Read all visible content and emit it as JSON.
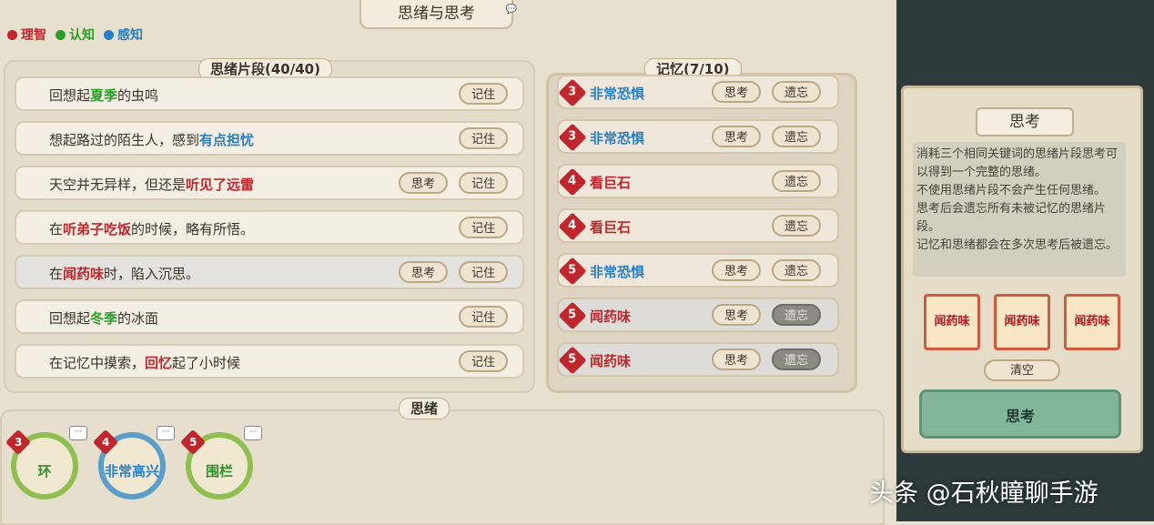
{
  "title": "思绪与思考",
  "legend": [
    {
      "label": "理智",
      "color": "#c0262b"
    },
    {
      "label": "认知",
      "color": "#2aa02a"
    },
    {
      "label": "感知",
      "color": "#2a7fc4"
    }
  ],
  "fragments": {
    "label": "思绪片段(40/40)",
    "rows": [
      {
        "pre": "回想起",
        "kw": "夏季",
        "kwColor": "#2aa02a",
        "post": "的虫鸣",
        "think": "",
        "remember": "记住"
      },
      {
        "pre": "想起路过的陌生人，感到",
        "kw": "有点担忧",
        "kwColor": "#2a7fc4",
        "post": "",
        "think": "",
        "remember": "记住"
      },
      {
        "pre": "天空并无异样，但还是",
        "kw": "听见了远雷",
        "kwColor": "#c0262b",
        "post": "",
        "think": "思考",
        "remember": "记住"
      },
      {
        "pre": "在",
        "kw": "听弟子吃饭",
        "kwColor": "#c0262b",
        "post": "的时候，略有所悟。",
        "think": "",
        "remember": "记住"
      },
      {
        "pre": "在",
        "kw": "闻药味",
        "kwColor": "#c0262b",
        "post": "时，陷入沉思。",
        "think": "思考",
        "remember": "记住"
      },
      {
        "pre": "回想起",
        "kw": "冬季",
        "kwColor": "#2aa02a",
        "post": "的冰面",
        "think": "",
        "remember": "记住"
      },
      {
        "pre": "在记忆中摸索，",
        "kw": "回忆",
        "kwColor": "#c0262b",
        "post": "起了小时候",
        "think": "",
        "remember": "记住"
      }
    ]
  },
  "memory": {
    "label": "记忆(7/10)",
    "rows": [
      {
        "level": "3",
        "text": "非常恐惧",
        "color": "#2a7fc4",
        "think": "思考",
        "forget": "遗忘",
        "gray": false
      },
      {
        "level": "3",
        "text": "非常恐惧",
        "color": "#2a7fc4",
        "think": "思考",
        "forget": "遗忘",
        "gray": false
      },
      {
        "level": "4",
        "text": "看巨石",
        "color": "#c0262b",
        "think": "",
        "forget": "遗忘",
        "gray": false
      },
      {
        "level": "4",
        "text": "看巨石",
        "color": "#c0262b",
        "think": "",
        "forget": "遗忘",
        "gray": false
      },
      {
        "level": "5",
        "text": "非常恐惧",
        "color": "#2a7fc4",
        "think": "思考",
        "forget": "遗忘",
        "gray": false
      },
      {
        "level": "5",
        "text": "闻药味",
        "color": "#c0262b",
        "think": "思考",
        "forget": "遗忘",
        "gray": true
      },
      {
        "level": "5",
        "text": "闻药味",
        "color": "#c0262b",
        "think": "思考",
        "forget": "遗忘",
        "gray": true
      }
    ]
  },
  "thoughts": {
    "label": "思绪",
    "items": [
      {
        "level": "3",
        "label": "环",
        "ring": "#8fc04f",
        "textColor": "#2c8f2c"
      },
      {
        "level": "4",
        "label": "非常高兴",
        "ring": "#5a9ec9",
        "textColor": "#2a7fc4"
      },
      {
        "level": "5",
        "label": "围栏",
        "ring": "#8fc04f",
        "textColor": "#2c8f2c"
      }
    ]
  },
  "side": {
    "title": "思考",
    "desc": [
      "消耗三个相同关键词的思绪片段思考可以得到一个完整的思绪。",
      "不使用思绪片段不会产生任何思绪。",
      "思考后会遗忘所有未被记忆的思绪片段。",
      "记忆和思绪都会在多次思考后被遗忘。"
    ],
    "slots": [
      "闻药味",
      "闻药味",
      "闻药味"
    ],
    "clear": "清空",
    "think_button": "思考"
  },
  "watermark": "头条 @石秋瞳聊手游"
}
